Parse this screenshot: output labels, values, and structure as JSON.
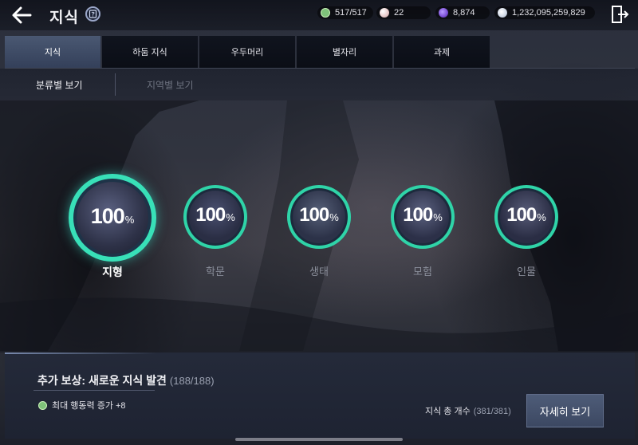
{
  "header": {
    "title": "지식",
    "resources": [
      {
        "icon": "stamina-icon",
        "value": "517/517",
        "color": "#7fc27a"
      },
      {
        "icon": "pearl-icon",
        "value": "22",
        "color": "#e8c9c9"
      },
      {
        "icon": "purple-crystal-icon",
        "value": "8,874",
        "color": "#7b4fd6"
      },
      {
        "icon": "silver-coin-icon",
        "value": "1,232,095,259,829",
        "color": "#cfd8e6"
      }
    ]
  },
  "tabs": [
    {
      "label": "지식",
      "active": true
    },
    {
      "label": "하둠 지식",
      "active": false
    },
    {
      "label": "우두머리",
      "active": false
    },
    {
      "label": "별자리",
      "active": false
    },
    {
      "label": "과제",
      "active": false
    }
  ],
  "view_filter": [
    {
      "label": "분류별 보기",
      "active": true
    },
    {
      "label": "지역별 보기",
      "active": false
    }
  ],
  "categories": [
    {
      "name": "지형",
      "percent": "100",
      "unit": "%",
      "selected": true
    },
    {
      "name": "학문",
      "percent": "100",
      "unit": "%",
      "selected": false
    },
    {
      "name": "생태",
      "percent": "100",
      "unit": "%",
      "selected": false
    },
    {
      "name": "모험",
      "percent": "100",
      "unit": "%",
      "selected": false
    },
    {
      "name": "인물",
      "percent": "100",
      "unit": "%",
      "selected": false
    }
  ],
  "reward": {
    "title": "추가 보상: 새로운 지식 발견",
    "count": "(188/188)",
    "bonus": "최대 행동력 증가 +8"
  },
  "total": {
    "label": "지식 총 개수",
    "count": "(381/381)"
  },
  "detail_button": "자세히 보기",
  "colors": {
    "accent_ring": "#2fd4a8",
    "active_tab": "#4a5872",
    "inactive_text": "#8a8e9a"
  }
}
